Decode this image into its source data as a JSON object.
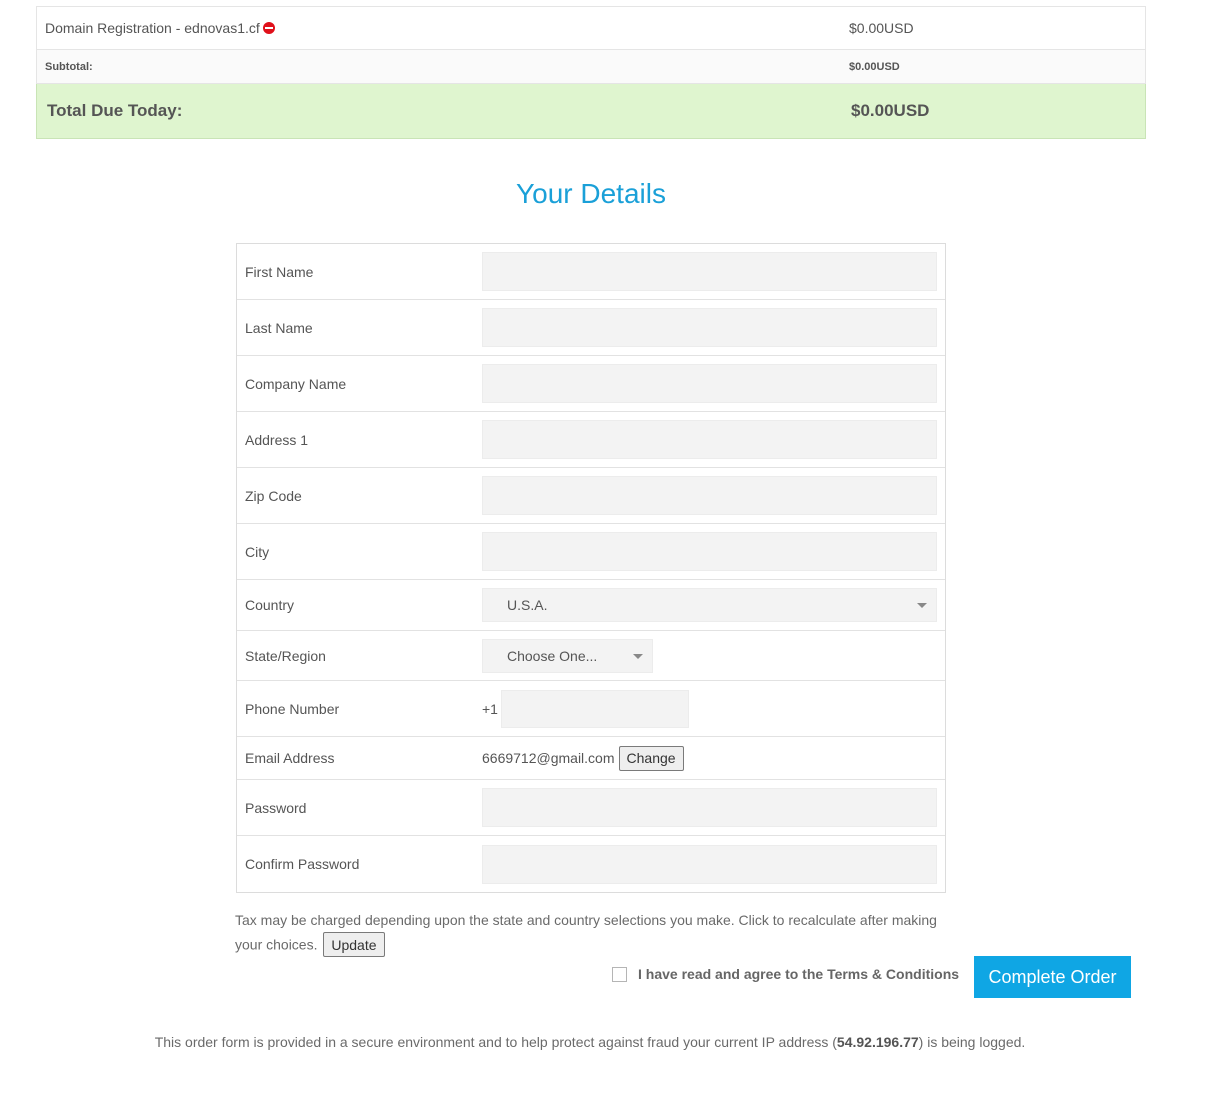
{
  "summary": {
    "item": {
      "label": "Domain Registration - ednovas1.cf",
      "price": "$0.00USD"
    },
    "subtotal": {
      "label": "Subtotal:",
      "value": "$0.00USD"
    },
    "total": {
      "label": "Total Due Today:",
      "value": "$0.00USD"
    }
  },
  "details": {
    "title": "Your Details",
    "fields": {
      "first_name": "First Name",
      "last_name": "Last Name",
      "company_name": "Company Name",
      "address1": "Address 1",
      "zip": "Zip Code",
      "city": "City",
      "country": "Country",
      "state": "State/Region",
      "phone": "Phone Number",
      "email": "Email Address",
      "password": "Password",
      "confirm_password": "Confirm Password"
    },
    "country_value": "U.S.A.",
    "state_value": "Choose One...",
    "phone_prefix": "+1",
    "email_value": "6669712@gmail.com",
    "change_label": "Change"
  },
  "tax": {
    "note": "Tax may be charged depending upon the state and country selections you make. Click to recalculate after making your choices.",
    "update_label": "Update"
  },
  "agree": {
    "prefix": "I have read and agree to the ",
    "link": "Terms & Conditions"
  },
  "submit_label": "Complete Order",
  "footer": {
    "before": "This order form is provided in a secure environment and to help protect against fraud your current IP address (",
    "ip": "54.92.196.77",
    "after": ") is being logged."
  },
  "colors": {
    "accent": "#0fa6e4",
    "title": "#1aa0d8",
    "total_bg": "#dff5cf",
    "remove": "#e0101a"
  }
}
